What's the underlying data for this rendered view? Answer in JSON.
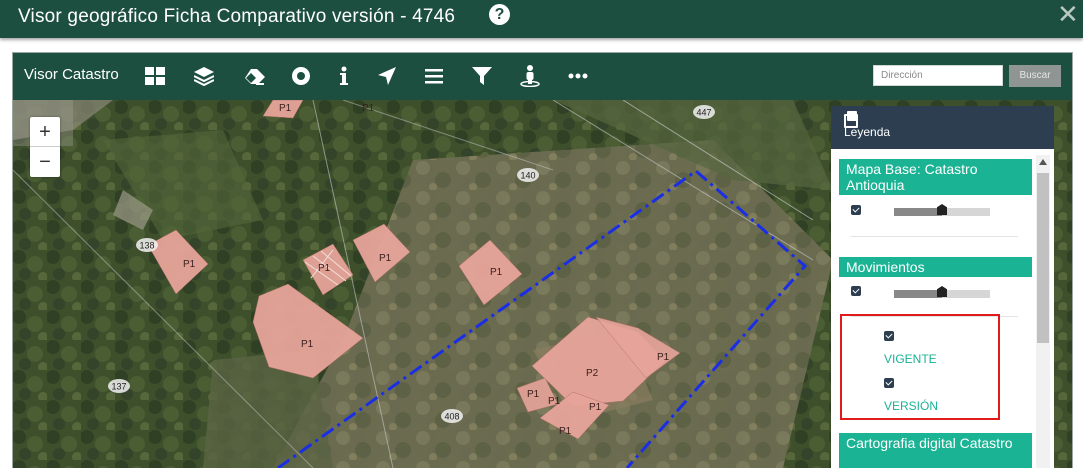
{
  "window": {
    "title": "Visor geográfico Ficha Comparativo versión - 4746",
    "help_icon": "question-circle-icon",
    "close_icon": "close-icon",
    "header_color": "#1d4f40"
  },
  "toolbar": {
    "brand": "Visor Catastro",
    "tools": [
      {
        "name": "basemap-gallery-icon"
      },
      {
        "name": "layers-icon"
      },
      {
        "name": "eraser-icon"
      },
      {
        "name": "record-icon"
      },
      {
        "name": "info-icon"
      },
      {
        "name": "locate-arrow-icon"
      },
      {
        "name": "list-icon"
      },
      {
        "name": "filter-icon"
      },
      {
        "name": "street-view-icon"
      },
      {
        "name": "more-icon"
      }
    ],
    "search_placeholder": "Dirección",
    "search_button": "Buscar"
  },
  "map": {
    "zoom_in": "+",
    "zoom_out": "−",
    "parcel_numbers": [
      "447",
      "140",
      "138",
      "137",
      "408"
    ],
    "building_labels": [
      "P1",
      "P1",
      "P1",
      "P1",
      "P1",
      "P1",
      "P1",
      "P2",
      "P1",
      "P1",
      "P1",
      "P1",
      "P1"
    ],
    "outline_color": "#1a2ee6",
    "building_color": "#e7a49a"
  },
  "legend": {
    "title": "Leyenda",
    "sections": [
      {
        "label": "Mapa Base: Catastro Antioquia",
        "opacity": 0.5
      },
      {
        "label": "Movimientos",
        "opacity": 0.5
      }
    ],
    "sublayers": [
      "VIGENTE",
      "VERSIÓN"
    ],
    "next_section": "Cartografia digital Catastro",
    "accent": "#1ab394",
    "highlight": "#e01b1b"
  }
}
